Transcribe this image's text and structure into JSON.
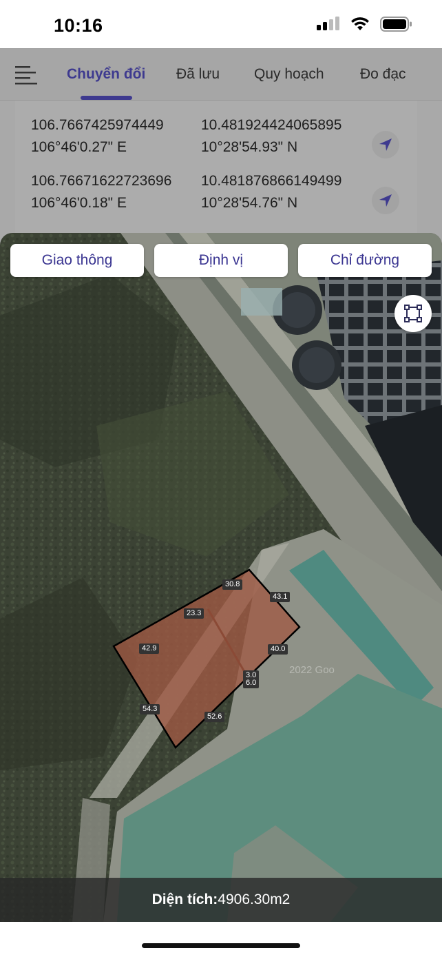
{
  "status": {
    "time": "10:16"
  },
  "nav": {
    "tabs": [
      {
        "label": "Chuyển đổi",
        "active": true
      },
      {
        "label": "Đã lưu"
      },
      {
        "label": "Quy hoạch"
      },
      {
        "label": "Đo đạc"
      }
    ],
    "menu_icon": "hamburger-icon"
  },
  "coords": [
    {
      "decimal_lon": "106.7667425974449",
      "decimal_lat": "10.481924424065895",
      "dms_lon": "106°46'0.27\" E",
      "dms_lat": "10°28'54.93\" N"
    },
    {
      "decimal_lon": "106.76671622723696",
      "decimal_lat": "10.481876866149499",
      "dms_lon": "106°46'0.18\" E",
      "dms_lat": "10°28'54.76\" N"
    }
  ],
  "map": {
    "buttons": {
      "traffic": "Giao thông",
      "locate": "Định vị",
      "directions": "Chỉ đường"
    },
    "draw_icon": "polygon-select-icon",
    "watermark": "2022 Goo",
    "edge_labels": [
      "30.8",
      "43.1",
      "23.3",
      "42.9",
      "40.0",
      "3.0",
      "6.0",
      "54.3",
      "52.6"
    ],
    "area_label": "Diện tích:",
    "area_value": "4906.30m2"
  },
  "colors": {
    "accent": "#3e3a8f",
    "parcel_fill": "#a05a44"
  }
}
